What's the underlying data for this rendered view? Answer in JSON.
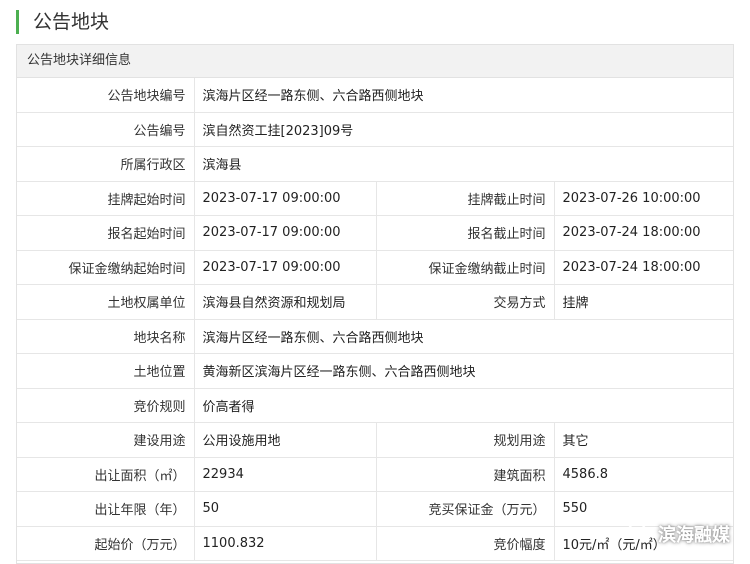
{
  "page_title": "公告地块",
  "section_title": "公告地块详细信息",
  "rows": [
    {
      "l1": "公告地块编号",
      "v1": "滨海片区经一路东侧、六合路西侧地块"
    },
    {
      "l1": "公告编号",
      "v1": "滨自然资工挂[2023]09号"
    },
    {
      "l1": "所属行政区",
      "v1": "滨海县"
    },
    {
      "l1": "挂牌起始时间",
      "v1": "2023-07-17 09:00:00",
      "l2": "挂牌截止时间",
      "v2": "2023-07-26 10:00:00"
    },
    {
      "l1": "报名起始时间",
      "v1": "2023-07-17 09:00:00",
      "l2": "报名截止时间",
      "v2": "2023-07-24 18:00:00"
    },
    {
      "l1": "保证金缴纳起始时间",
      "v1": "2023-07-17 09:00:00",
      "l2": "保证金缴纳截止时间",
      "v2": "2023-07-24 18:00:00"
    },
    {
      "l1": "土地权属单位",
      "v1": "滨海县自然资源和规划局",
      "l2": "交易方式",
      "v2": "挂牌"
    },
    {
      "l1": "地块名称",
      "v1": "滨海片区经一路东侧、六合路西侧地块"
    },
    {
      "l1": "土地位置",
      "v1": "黄海新区滨海片区经一路东侧、六合路西侧地块"
    },
    {
      "l1": "竞价规则",
      "v1": "价高者得"
    },
    {
      "l1": "建设用途",
      "v1": "公用设施用地",
      "l2": "规划用途",
      "v2": "其它"
    },
    {
      "l1": "出让面积（㎡）",
      "v1": "22934",
      "l2": "建筑面积",
      "v2": "4586.8"
    },
    {
      "l1": "出让年限（年）",
      "v1": "50",
      "l2": "竞买保证金（万元）",
      "v2": "550"
    },
    {
      "l1": "起始价（万元）",
      "v1": "1100.832",
      "l2": "竞价幅度",
      "v2": "10元/㎡（元/㎡）"
    }
  ],
  "watermark": "滨海融媒"
}
